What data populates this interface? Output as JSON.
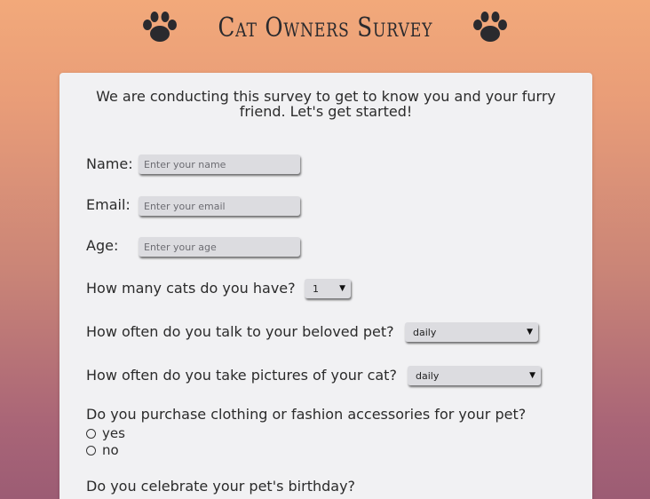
{
  "header": {
    "title": "Cat Owners Survey",
    "left_icon": "paw-icon",
    "right_icon": "paw-icon"
  },
  "intro": "We are conducting this survey to get to know you and your furry friend. Let's get started!",
  "fields": {
    "name": {
      "label": "Name:",
      "placeholder": "Enter your name"
    },
    "email": {
      "label": "Email:",
      "placeholder": "Enter your email"
    },
    "age": {
      "label": "Age:",
      "placeholder": "Enter your age"
    }
  },
  "questions": {
    "cat_count": {
      "label": "How many cats do you have?",
      "selected": "1"
    },
    "talk_frequency": {
      "label": "How often do you talk to your beloved pet?",
      "selected": "daily"
    },
    "picture_frequency": {
      "label": "How often do you take pictures of your cat?",
      "selected": "daily"
    },
    "clothing": {
      "label": "Do you purchase clothing or fashion accessories for your pet?",
      "options": [
        "yes",
        "no"
      ]
    },
    "birthday": {
      "label": "Do you celebrate your pet's birthday?"
    }
  },
  "colors": {
    "background_top": "#f2a97a",
    "background_bottom": "#9c5c74",
    "card": "#f1f1f3",
    "input": "#dcdce0"
  }
}
